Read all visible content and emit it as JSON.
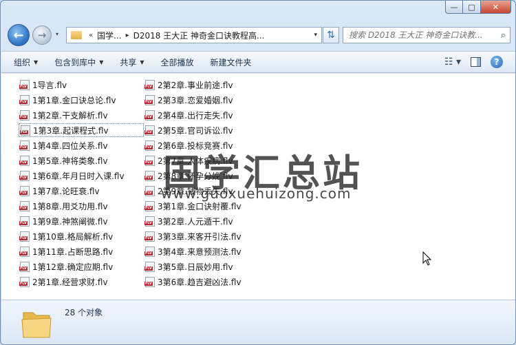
{
  "window": {
    "caption": {
      "minimize": "—",
      "maximize": "□",
      "close": "✕"
    }
  },
  "nav": {
    "back_glyph": "←",
    "forward_glyph": "→",
    "recent_glyph": "▾"
  },
  "address": {
    "overflow": "«",
    "segments": [
      "国学...",
      "D2018 王大正 神奇金口诀教程高..."
    ],
    "separator": "▸",
    "dropdown": "▾"
  },
  "refresh_glyph": "⇅",
  "search": {
    "placeholder": "搜索 D2018 王大正 神奇金口诀教...",
    "icon": "⌕"
  },
  "toolbar": {
    "items": [
      {
        "label": "组织",
        "has_arrow": true
      },
      {
        "label": "包含到库中",
        "has_arrow": true
      },
      {
        "label": "共享",
        "has_arrow": true
      },
      {
        "label": "全部播放",
        "has_arrow": false
      },
      {
        "label": "新建文件夹",
        "has_arrow": false
      }
    ],
    "arrow": "▼",
    "view_glyph": "☷ ▾",
    "help_glyph": "?"
  },
  "files": [
    "1导言.flv",
    "1第1章.金口诀总论.flv",
    "1第2章.干支解析.flv",
    "1第3章.起课程式.flv",
    "1第4章.四位关系.flv",
    "1第5章.神将类象.flv",
    "1第6章.年月日时入课.flv",
    "1第7章.论旺衰.flv",
    "1第8章.用爻功用.flv",
    "1第9章.神煞阐微.flv",
    "1第10章.格局解析.flv",
    "1第11章.占断思路.flv",
    "1第12章.确定应期.flv",
    "2第1章.经营求财.flv",
    "2第2章.事业前途.flv",
    "2第3章.恋爱婚姻.flv",
    "2第4章.出行走失.flv",
    "2第5章.官司诉讼.flv",
    "2第6章.投标竞赛.flv",
    "2第7章.人体疾病.flv",
    "2第8章.怀孕分娩.flv",
    "2第9章.钱物丢失.flv",
    "3第1章.金口诀射覆.flv",
    "3第2章.人元遁干.flv",
    "3第3章.来客开引法.flv",
    "3第4章.来意预测法.flv",
    "3第5章.日辰妙用.flv",
    "3第6章.趋吉避凶法.flv"
  ],
  "focused_index": 3,
  "watermark": {
    "title": "国学汇总站",
    "url": "www.guoxuehuizong.com"
  },
  "status": {
    "count_text": "28 个对象"
  }
}
